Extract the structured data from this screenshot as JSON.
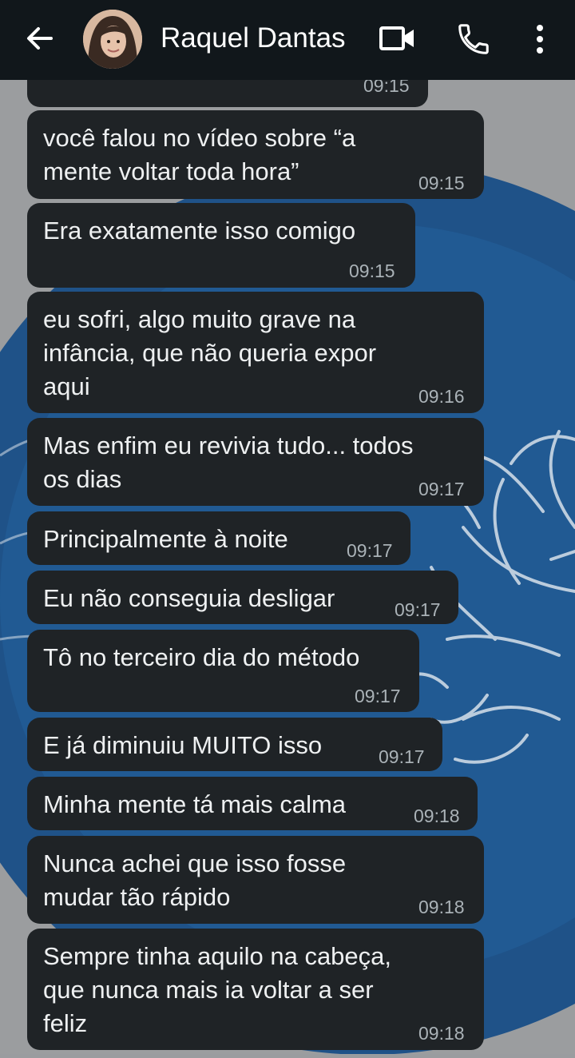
{
  "header": {
    "contact_name": "Raquel Dantas",
    "icons": [
      "back-arrow-icon",
      "avatar",
      "video-camera-icon",
      "phone-icon",
      "more-vert-icon"
    ],
    "background": "#11171b"
  },
  "chat": {
    "bubble_color": "#1f2326",
    "text_color": "#eef0f1",
    "time_color": "#aab2b7",
    "messages": [
      {
        "lines": [],
        "time": "09:15"
      },
      {
        "lines": [
          "você falou no vídeo sobre “a",
          "mente voltar toda hora”"
        ],
        "time": "09:15"
      },
      {
        "lines": [
          "Era exatamente isso comigo"
        ],
        "time": "09:15"
      },
      {
        "lines": [
          "eu sofri, algo muito grave na",
          "infância, que não queria expor",
          "aqui"
        ],
        "time": "09:16"
      },
      {
        "lines": [
          "Mas enfim eu revivia tudo... todos",
          "os dias"
        ],
        "time": "09:17"
      },
      {
        "lines": [
          "Principalmente à noite"
        ],
        "time": "09:17"
      },
      {
        "lines": [
          "Eu não conseguia desligar"
        ],
        "time": "09:17"
      },
      {
        "lines": [
          "Tô no terceiro dia do método"
        ],
        "time": "09:17"
      },
      {
        "lines": [
          "E já diminuiu MUITO isso"
        ],
        "time": "09:17"
      },
      {
        "lines": [
          "Minha mente tá mais calma"
        ],
        "time": "09:18"
      },
      {
        "lines": [
          "Nunca achei que isso fosse",
          "mudar tão rápido"
        ],
        "time": "09:18"
      },
      {
        "lines": [
          "Sempre tinha aquilo na cabeça,",
          "que nunca mais ia voltar a ser",
          "feliz"
        ],
        "time": "09:18"
      }
    ]
  }
}
